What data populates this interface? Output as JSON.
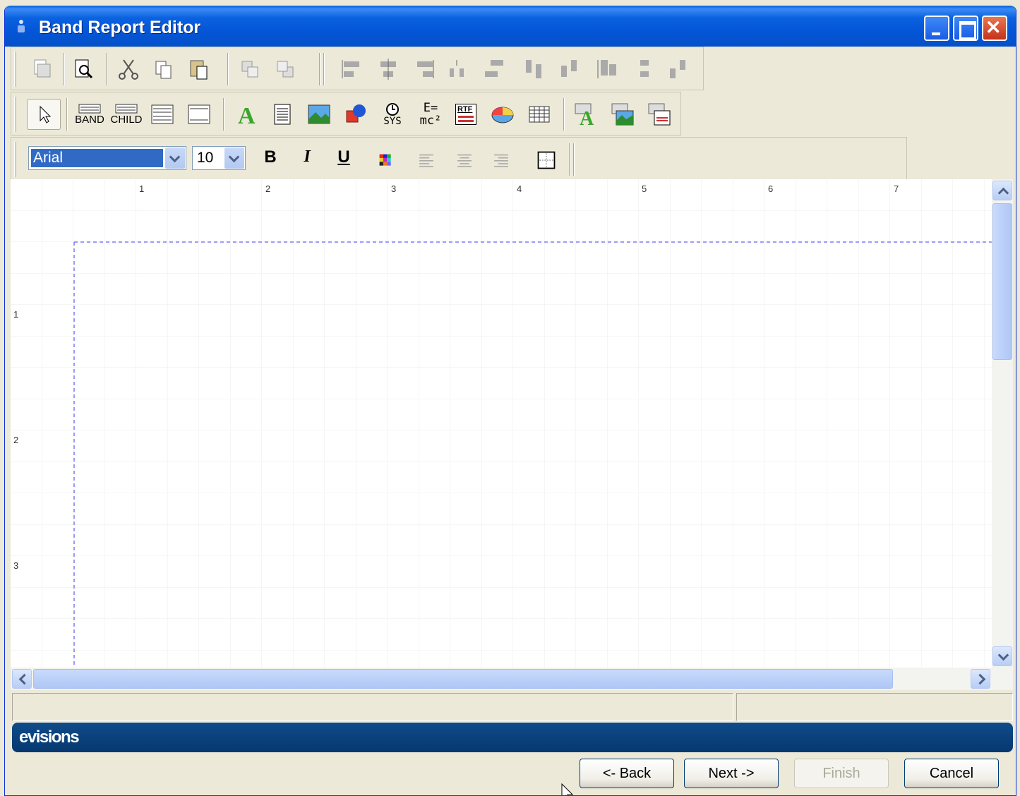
{
  "window": {
    "title": "Band Report Editor"
  },
  "title_buttons": [
    "minimize-button",
    "maximize-button",
    "close-button"
  ],
  "toolbar1": {
    "icons": [
      "page-setup-icon",
      "print-preview-icon",
      "cut-icon",
      "copy-icon",
      "paste-icon",
      "bring-to-front-icon",
      "send-to-back-icon",
      "align-left-icon",
      "align-horizontal-center-icon",
      "align-right-icon",
      "center-horizontally-icon",
      "space-horizontally-icon",
      "align-top-icon",
      "align-vertical-center-icon",
      "align-bottom-icon",
      "center-vertically-icon",
      "space-vertically-icon"
    ]
  },
  "toolbar2": {
    "band_label": "BAND",
    "child_label": "CHILD",
    "sys_label": "SYS",
    "expr_label_top": "E=",
    "expr_label_bottom": "mc²",
    "rtf_label": "RTF",
    "icons": [
      "select-pointer-icon",
      "band-icon",
      "child-band-icon",
      "subdetail-band-icon",
      "group-band-icon",
      "label-icon",
      "memo-icon",
      "image-icon",
      "shape-icon",
      "system-data-icon",
      "expression-icon",
      "rich-text-icon",
      "chart-icon",
      "table-icon",
      "db-text-icon",
      "db-image-icon",
      "db-richtext-icon"
    ]
  },
  "toolbar3": {
    "font_name": "Arial",
    "font_size": "10",
    "bold_label": "B",
    "italic_label": "I",
    "underline_label": "U",
    "icons": [
      "font-color-icon",
      "align-text-left-icon",
      "align-text-center-icon",
      "align-text-right-icon",
      "frame-borders-icon"
    ]
  },
  "ruler": {
    "horizontal": [
      "1",
      "2",
      "3",
      "4",
      "5",
      "6",
      "7"
    ],
    "vertical": [
      "1",
      "2",
      "3"
    ]
  },
  "banner": {
    "brand": "evisions"
  },
  "buttons": {
    "back": "<- Back",
    "next": "Next ->",
    "finish": "Finish",
    "cancel": "Cancel"
  }
}
